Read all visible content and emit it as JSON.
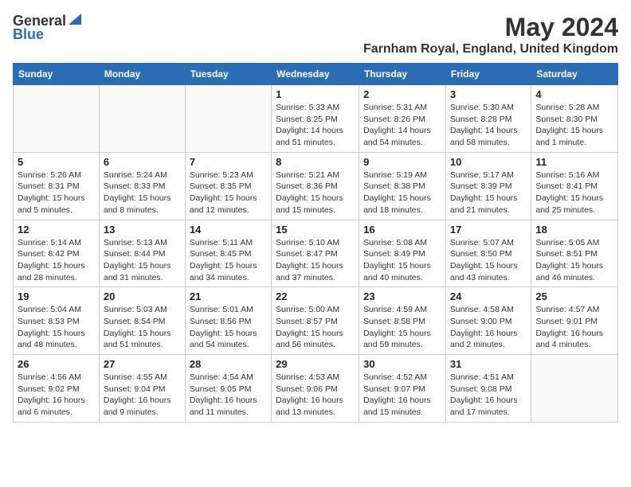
{
  "logo": {
    "general": "General",
    "blue": "Blue"
  },
  "title": "May 2024",
  "location": "Farnham Royal, England, United Kingdom",
  "weekdays": [
    "Sunday",
    "Monday",
    "Tuesday",
    "Wednesday",
    "Thursday",
    "Friday",
    "Saturday"
  ],
  "weeks": [
    [
      {
        "day": "",
        "info": ""
      },
      {
        "day": "",
        "info": ""
      },
      {
        "day": "",
        "info": ""
      },
      {
        "day": "1",
        "info": "Sunrise: 5:33 AM\nSunset: 8:25 PM\nDaylight: 14 hours\nand 51 minutes."
      },
      {
        "day": "2",
        "info": "Sunrise: 5:31 AM\nSunset: 8:26 PM\nDaylight: 14 hours\nand 54 minutes."
      },
      {
        "day": "3",
        "info": "Sunrise: 5:30 AM\nSunset: 8:28 PM\nDaylight: 14 hours\nand 58 minutes."
      },
      {
        "day": "4",
        "info": "Sunrise: 5:28 AM\nSunset: 8:30 PM\nDaylight: 15 hours\nand 1 minute."
      }
    ],
    [
      {
        "day": "5",
        "info": "Sunrise: 5:26 AM\nSunset: 8:31 PM\nDaylight: 15 hours\nand 5 minutes."
      },
      {
        "day": "6",
        "info": "Sunrise: 5:24 AM\nSunset: 8:33 PM\nDaylight: 15 hours\nand 8 minutes."
      },
      {
        "day": "7",
        "info": "Sunrise: 5:23 AM\nSunset: 8:35 PM\nDaylight: 15 hours\nand 12 minutes."
      },
      {
        "day": "8",
        "info": "Sunrise: 5:21 AM\nSunset: 8:36 PM\nDaylight: 15 hours\nand 15 minutes."
      },
      {
        "day": "9",
        "info": "Sunrise: 5:19 AM\nSunset: 8:38 PM\nDaylight: 15 hours\nand 18 minutes."
      },
      {
        "day": "10",
        "info": "Sunrise: 5:17 AM\nSunset: 8:39 PM\nDaylight: 15 hours\nand 21 minutes."
      },
      {
        "day": "11",
        "info": "Sunrise: 5:16 AM\nSunset: 8:41 PM\nDaylight: 15 hours\nand 25 minutes."
      }
    ],
    [
      {
        "day": "12",
        "info": "Sunrise: 5:14 AM\nSunset: 8:42 PM\nDaylight: 15 hours\nand 28 minutes."
      },
      {
        "day": "13",
        "info": "Sunrise: 5:13 AM\nSunset: 8:44 PM\nDaylight: 15 hours\nand 31 minutes."
      },
      {
        "day": "14",
        "info": "Sunrise: 5:11 AM\nSunset: 8:45 PM\nDaylight: 15 hours\nand 34 minutes."
      },
      {
        "day": "15",
        "info": "Sunrise: 5:10 AM\nSunset: 8:47 PM\nDaylight: 15 hours\nand 37 minutes."
      },
      {
        "day": "16",
        "info": "Sunrise: 5:08 AM\nSunset: 8:49 PM\nDaylight: 15 hours\nand 40 minutes."
      },
      {
        "day": "17",
        "info": "Sunrise: 5:07 AM\nSunset: 8:50 PM\nDaylight: 15 hours\nand 43 minutes."
      },
      {
        "day": "18",
        "info": "Sunrise: 5:05 AM\nSunset: 8:51 PM\nDaylight: 15 hours\nand 46 minutes."
      }
    ],
    [
      {
        "day": "19",
        "info": "Sunrise: 5:04 AM\nSunset: 8:53 PM\nDaylight: 15 hours\nand 48 minutes."
      },
      {
        "day": "20",
        "info": "Sunrise: 5:03 AM\nSunset: 8:54 PM\nDaylight: 15 hours\nand 51 minutes."
      },
      {
        "day": "21",
        "info": "Sunrise: 5:01 AM\nSunset: 8:56 PM\nDaylight: 15 hours\nand 54 minutes."
      },
      {
        "day": "22",
        "info": "Sunrise: 5:00 AM\nSunset: 8:57 PM\nDaylight: 15 hours\nand 56 minutes."
      },
      {
        "day": "23",
        "info": "Sunrise: 4:59 AM\nSunset: 8:58 PM\nDaylight: 15 hours\nand 59 minutes."
      },
      {
        "day": "24",
        "info": "Sunrise: 4:58 AM\nSunset: 9:00 PM\nDaylight: 16 hours\nand 2 minutes."
      },
      {
        "day": "25",
        "info": "Sunrise: 4:57 AM\nSunset: 9:01 PM\nDaylight: 16 hours\nand 4 minutes."
      }
    ],
    [
      {
        "day": "26",
        "info": "Sunrise: 4:56 AM\nSunset: 9:02 PM\nDaylight: 16 hours\nand 6 minutes."
      },
      {
        "day": "27",
        "info": "Sunrise: 4:55 AM\nSunset: 9:04 PM\nDaylight: 16 hours\nand 9 minutes."
      },
      {
        "day": "28",
        "info": "Sunrise: 4:54 AM\nSunset: 9:05 PM\nDaylight: 16 hours\nand 11 minutes."
      },
      {
        "day": "29",
        "info": "Sunrise: 4:53 AM\nSunset: 9:06 PM\nDaylight: 16 hours\nand 13 minutes."
      },
      {
        "day": "30",
        "info": "Sunrise: 4:52 AM\nSunset: 9:07 PM\nDaylight: 16 hours\nand 15 minutes."
      },
      {
        "day": "31",
        "info": "Sunrise: 4:51 AM\nSunset: 9:08 PM\nDaylight: 16 hours\nand 17 minutes."
      },
      {
        "day": "",
        "info": ""
      }
    ]
  ]
}
